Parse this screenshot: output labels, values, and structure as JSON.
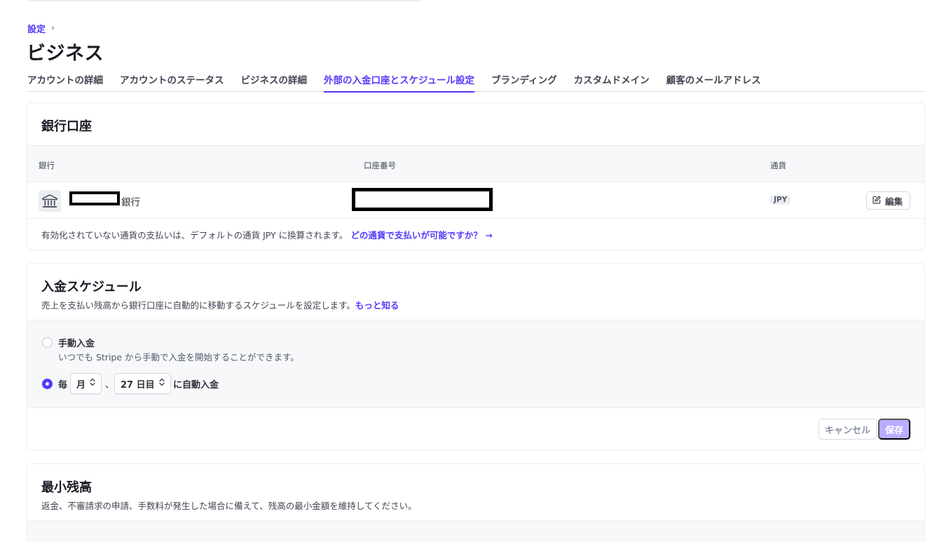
{
  "breadcrumb": {
    "parent": "設定",
    "separator": "›"
  },
  "page_title": "ビジネス",
  "tabs": [
    {
      "label": "アカウントの詳細",
      "active": false
    },
    {
      "label": "アカウントのステータス",
      "active": false
    },
    {
      "label": "ビジネスの詳細",
      "active": false
    },
    {
      "label": "外部の入金口座とスケジュール設定",
      "active": true
    },
    {
      "label": "ブランディング",
      "active": false
    },
    {
      "label": "カスタムドメイン",
      "active": false
    },
    {
      "label": "顧客のメールアドレス",
      "active": false
    }
  ],
  "bank_accounts": {
    "title": "銀行口座",
    "columns": {
      "bank": "銀行",
      "account_number": "口座番号",
      "currency": "通貨"
    },
    "row": {
      "bank_suffix": "銀行",
      "currency": "JPY",
      "edit_label": "編集"
    },
    "note_text": "有効化されていない通貨の支払いは、デフォルトの通貨 JPY に換算されます。",
    "note_link": "どの通貨で支払いが可能ですか？ →"
  },
  "payout_schedule": {
    "title": "入金スケジュール",
    "description": "売上を支払い残高から銀行口座に自動的に移動するスケジュールを設定します。",
    "learn_more": "もっと知る",
    "options": {
      "manual": {
        "label": "手動入金",
        "description": "いつでも Stripe から手動で入金を開始することができます。",
        "selected": false
      },
      "automatic": {
        "prefix": "毎",
        "interval_value": "月",
        "separator": "、",
        "day_value": "27 日目",
        "suffix": "に自動入金",
        "selected": true
      }
    },
    "cancel_label": "キャンセル",
    "save_label": "保存"
  },
  "minimum_balance": {
    "title": "最小残高",
    "description": "返金、不審請求の申請、手数料が発生した場合に備えて、残高の最小金額を維持してください。"
  },
  "colors": {
    "accent": "#533afd",
    "save_disabled": "#b8adff",
    "panel_bg": "#f6f8fa",
    "border": "#ebeef1"
  }
}
